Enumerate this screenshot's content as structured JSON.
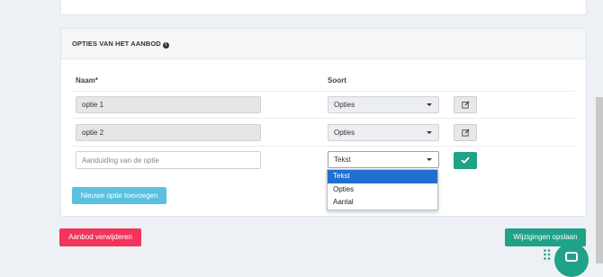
{
  "panel": {
    "title": "OPTIES VAN HET AANBOD",
    "columns": {
      "name": "Naam*",
      "type": "Soort"
    },
    "rows": [
      {
        "name": "optie 1",
        "type": "Opties"
      },
      {
        "name": "optie 2",
        "type": "Opties"
      }
    ],
    "new_row": {
      "placeholder": "Aanduiding van de optie",
      "type": "Tekst"
    },
    "type_options": [
      "Tekst",
      "Opties",
      "Aantal"
    ],
    "add_label": "Nieuwe optie toevoegen"
  },
  "footer": {
    "delete_label": "Aanbod verwijderen",
    "save_label": "Wijzigingen opslaan"
  },
  "colors": {
    "primary_green": "#1fa287",
    "danger_red": "#f2355d",
    "info_blue": "#5bc0de",
    "selected_blue": "#1e6fd0"
  }
}
